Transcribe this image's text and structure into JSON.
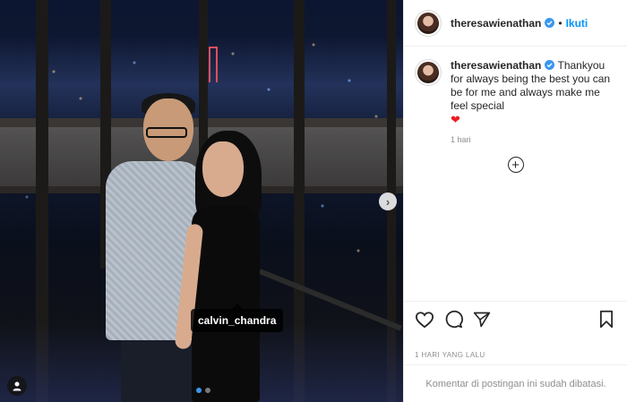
{
  "post": {
    "username": "theresawienathan",
    "follow_label": "Ikuti",
    "separator": "•",
    "caption": "Thankyou for always being the best you can be for me and always make me feel special",
    "caption_emoji": "❤",
    "comment_age": "1 hari",
    "date_label": "1 HARI YANG LALU",
    "comments_disabled_text": "Komentar di postingan ini sudah dibatasi."
  },
  "photo": {
    "tagged_user": "calvin_chandra",
    "carousel_count": 2,
    "carousel_active": 1,
    "next_icon": "chevron-right-icon",
    "tag_icon": "user-icon"
  },
  "icons": {
    "verified": "verified-badge-icon",
    "like": "heart-icon",
    "comment": "comment-icon",
    "share": "paper-plane-icon",
    "save": "bookmark-icon",
    "load_more": "plus-circle-icon"
  },
  "colors": {
    "link_blue": "#0095f6",
    "verified_blue": "#3897f0",
    "muted_text": "#8e8e8e",
    "heart_red": "#ed1c24"
  }
}
